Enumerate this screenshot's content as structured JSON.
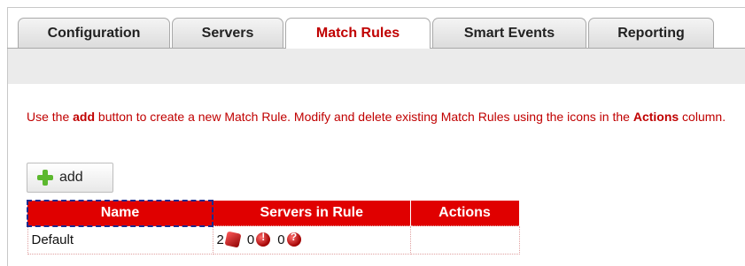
{
  "tabs": [
    {
      "label": "Configuration"
    },
    {
      "label": "Servers"
    },
    {
      "label": "Match Rules"
    },
    {
      "label": "Smart Events"
    },
    {
      "label": "Reporting"
    }
  ],
  "info": {
    "part1": "Use the ",
    "bold1": "add",
    "part2": " button to create a new Match Rule. Modify and delete existing Match Rules using the icons in the ",
    "bold2": "Actions",
    "part3": " column."
  },
  "add_button": {
    "label": "add"
  },
  "table": {
    "headers": [
      "Name",
      "Servers in Rule",
      "Actions"
    ],
    "rows": [
      {
        "name": "Default",
        "servers_total": "2",
        "servers_warn": "0",
        "servers_unknown": "0"
      }
    ]
  },
  "colors": {
    "accent": "#e00000",
    "active_tab_text": "#c00000",
    "info_text": "#c00000"
  },
  "icons": [
    "plus-icon",
    "server-cube-icon",
    "warning-icon",
    "unknown-icon"
  ]
}
